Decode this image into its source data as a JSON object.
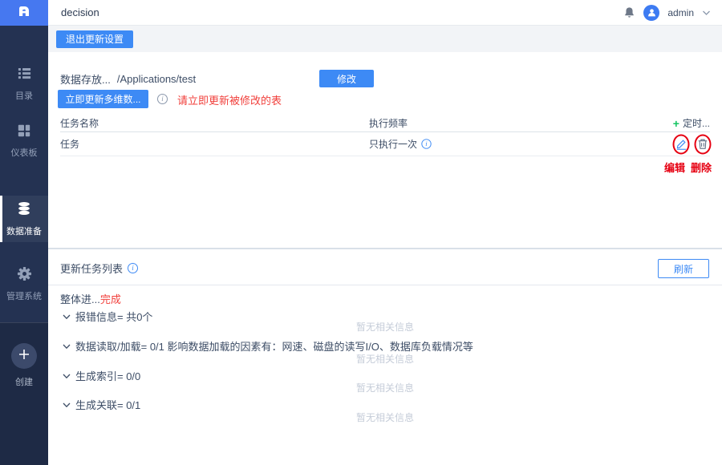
{
  "header": {
    "title": "decision",
    "user": "admin"
  },
  "sidebar": {
    "items": [
      {
        "label": "目录"
      },
      {
        "label": "仪表板"
      },
      {
        "label": "数据准备"
      },
      {
        "label": "管理系统"
      }
    ],
    "create_label": "创建"
  },
  "toolbar": {
    "exit_update_settings": "退出更新设置"
  },
  "storage": {
    "label": "数据存放...",
    "path": "/Applications/test",
    "modify_button": "修改"
  },
  "update_now": {
    "button": "立即更新多维数...",
    "warning": "请立即更新被修改的表"
  },
  "task_table": {
    "columns": [
      "任务名称",
      "执行频率"
    ],
    "add_schedule": "定时...",
    "rows": [
      {
        "name": "任务",
        "frequency": "只执行一次"
      }
    ],
    "annotations": {
      "edit": "编辑",
      "delete": "删除"
    }
  },
  "update_list": {
    "title": "更新任务列表",
    "refresh_button": "刷新",
    "overall_label": "整体进...",
    "overall_status": "完成",
    "sections": [
      {
        "label": "报错信息= 共0个",
        "empty": "暂无相关信息"
      },
      {
        "label": "数据读取/加载= 0/1 影响数据加载的因素有：网速、磁盘的读写I/O、数据库负载情况等",
        "empty": "暂无相关信息"
      },
      {
        "label": "生成索引= 0/0",
        "empty": "暂无相关信息"
      },
      {
        "label": "生成关联= 0/1",
        "empty": "暂无相关信息"
      }
    ]
  },
  "colors": {
    "accent": "#3d8af5",
    "warning": "#f1403c",
    "annotation": "#e60012",
    "sidebar": "#243252",
    "green": "#14c562"
  }
}
